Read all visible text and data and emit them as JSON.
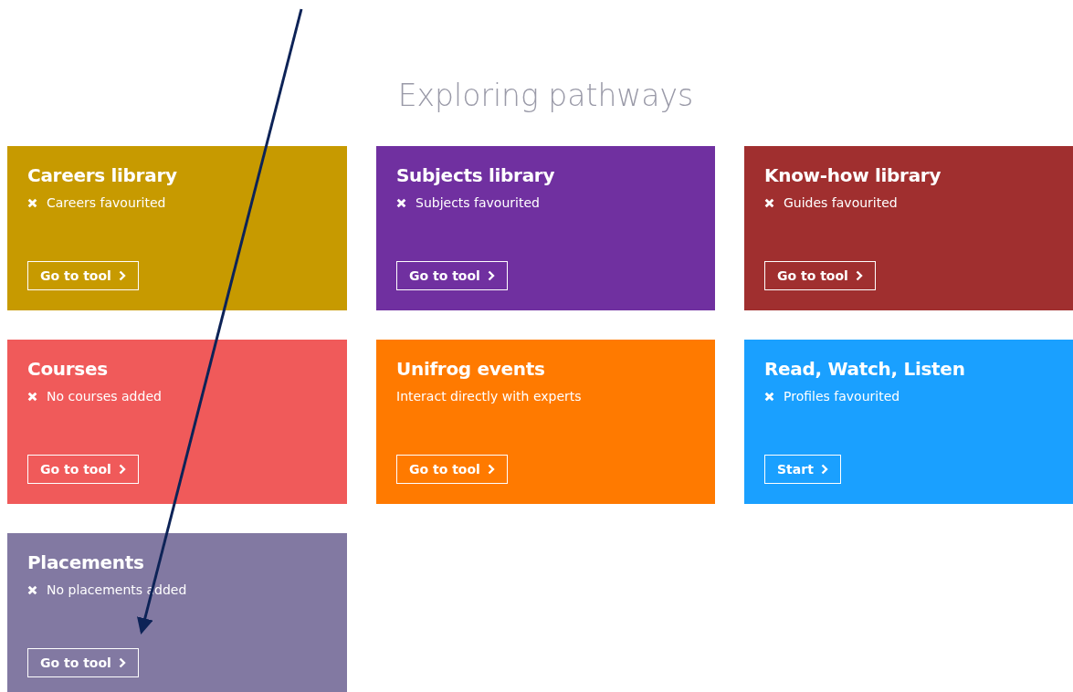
{
  "heading": "Exploring pathways",
  "cards": [
    {
      "title": "Careers library",
      "kind": "status",
      "note": "Careers favourited",
      "button": "Go to tool",
      "color": "#c79a00"
    },
    {
      "title": "Subjects library",
      "kind": "status",
      "note": "Subjects favourited",
      "button": "Go to tool",
      "color": "#7030a0"
    },
    {
      "title": "Know-how library",
      "kind": "status",
      "note": "Guides favourited",
      "button": "Go to tool",
      "color": "#a02f2f"
    },
    {
      "title": "Courses",
      "kind": "status",
      "note": "No courses added",
      "button": "Go to tool",
      "color": "#f05a5a"
    },
    {
      "title": "Unifrog events",
      "kind": "text",
      "note": "Interact directly with experts",
      "button": "Go to tool",
      "color": "#ff7a00"
    },
    {
      "title": "Read, Watch, Listen",
      "kind": "status",
      "note": "Profiles favourited",
      "button": "Start",
      "color": "#1aa0ff"
    },
    {
      "title": "Placements",
      "kind": "status",
      "note": "No placements added",
      "button": "Go to tool",
      "color": "#8279a2"
    }
  ]
}
